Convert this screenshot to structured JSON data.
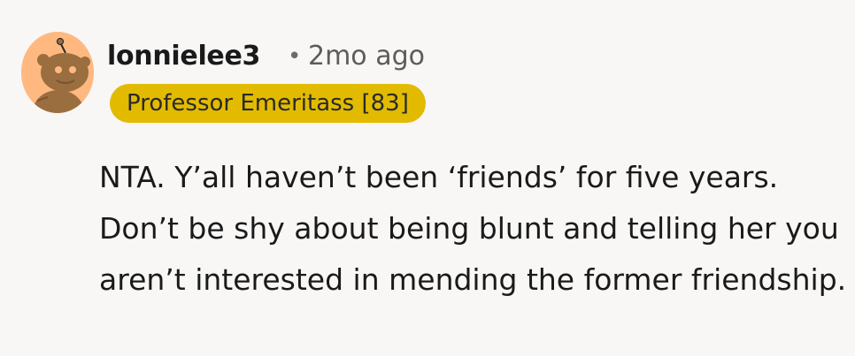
{
  "comment": {
    "username": "lonnielee3",
    "separator": "•",
    "timestamp": "2mo ago",
    "flair": "Professor Emeritass [83]",
    "text": "NTA. Y’all haven’t been ‘friends’ for five years. Don’t be shy about being blunt and telling her you aren’t interested in mending the former friendship."
  },
  "colors": {
    "avatar_background": "#ffb980",
    "flair_background": "#e2bb00",
    "page_background": "#f8f7f6"
  },
  "icons": {
    "avatar": "snoo-avatar-icon"
  }
}
